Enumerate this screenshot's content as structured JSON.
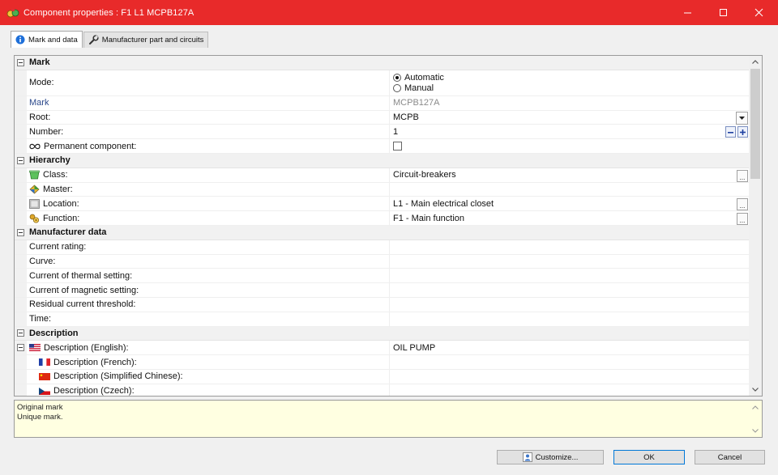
{
  "window": {
    "title": "Component properties : F1 L1 MCPB127A"
  },
  "tabs": [
    {
      "label": "Mark and data"
    },
    {
      "label": "Manufacturer part and circuits"
    }
  ],
  "sections": {
    "mark": {
      "title": "Mark",
      "mode_label": "Mode:",
      "mode_options": [
        "Automatic",
        "Manual"
      ],
      "mark_label": "Mark",
      "mark_value": "MCPB127A",
      "root_label": "Root:",
      "root_value": "MCPB",
      "number_label": "Number:",
      "number_value": "1",
      "permanent_label": "Permanent component:"
    },
    "hierarchy": {
      "title": "Hierarchy",
      "class_label": "Class:",
      "class_value": "Circuit-breakers",
      "master_label": "Master:",
      "location_label": "Location:",
      "location_value": "L1 - Main electrical closet",
      "function_label": "Function:",
      "function_value": "F1 - Main function"
    },
    "manufacturer": {
      "title": "Manufacturer data",
      "rows": [
        "Current rating:",
        "Curve:",
        "Current of thermal setting:",
        "Current of magnetic setting:",
        "Residual current threshold:",
        "Time:"
      ]
    },
    "description": {
      "title": "Description",
      "english_label": "Description (English):",
      "english_value": "OIL PUMP",
      "french_label": "Description (French):",
      "chinese_label": "Description (Simplified Chinese):",
      "czech_label": "Description (Czech):"
    }
  },
  "help": {
    "line1": "Original mark",
    "line2": "Unique mark."
  },
  "buttons": {
    "customize": "Customize...",
    "ok": "OK",
    "cancel": "Cancel"
  },
  "colors": {
    "titlebar": "#e82a2a",
    "help_background": "#ffffe1",
    "primary_border": "#0078d7"
  }
}
